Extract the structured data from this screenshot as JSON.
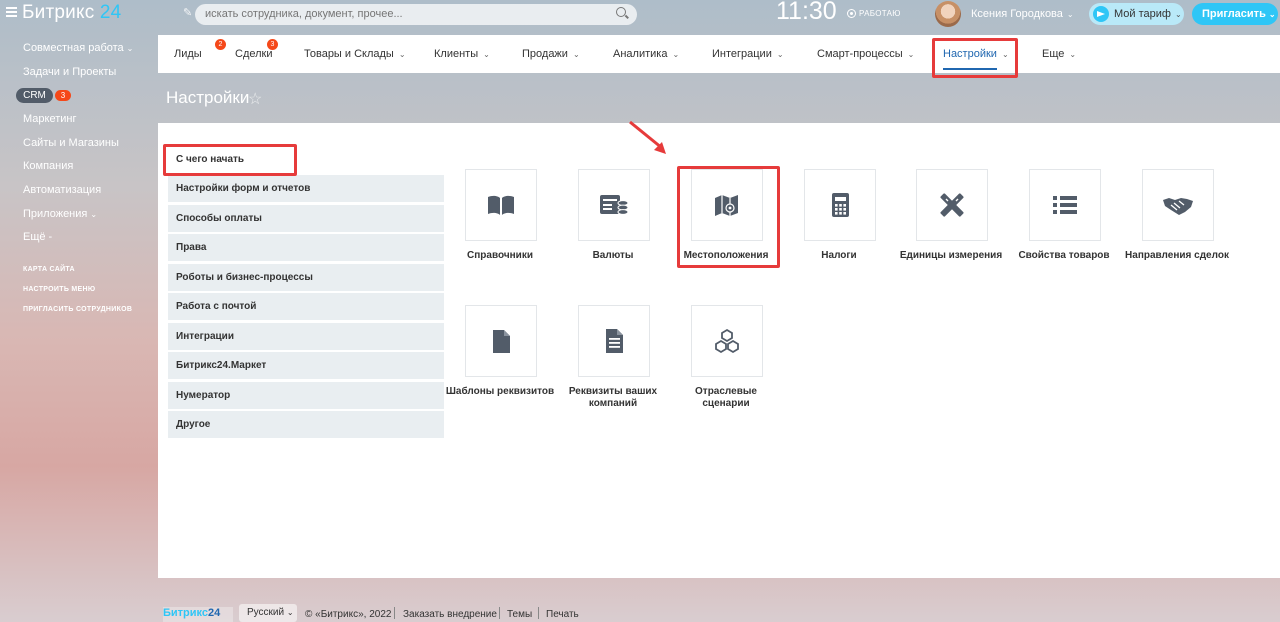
{
  "header": {
    "logo_text": "Битрикс",
    "logo_num": "24",
    "search_placeholder": "искать сотрудника, документ, прочее...",
    "time": "11:30",
    "work_status": "РАБОТАЮ",
    "user_name": "Ксения Городкова",
    "tariff_label": "Мой тариф",
    "invite_label": "Пригласить"
  },
  "sidebar": {
    "items": [
      {
        "label": "Совместная работа",
        "has_caret": true
      },
      {
        "label": "Задачи и Проекты"
      },
      {
        "label": "CRM",
        "badge": "3"
      },
      {
        "label": "Маркетинг"
      },
      {
        "label": "Сайты и Магазины"
      },
      {
        "label": "Компания"
      },
      {
        "label": "Автоматизация"
      },
      {
        "label": "Приложения",
        "has_caret": true
      },
      {
        "label": "Ещё -"
      }
    ],
    "small_links": [
      "КАРТА САЙТА",
      "НАСТРОИТЬ МЕНЮ",
      "ПРИГЛАСИТЬ СОТРУДНИКОВ"
    ]
  },
  "tabs": [
    {
      "label": "Лиды",
      "count": "2"
    },
    {
      "label": "Сделки",
      "count": "3"
    },
    {
      "label": "Товары и Склады"
    },
    {
      "label": "Клиенты"
    },
    {
      "label": "Продажи"
    },
    {
      "label": "Аналитика"
    },
    {
      "label": "Интеграции"
    },
    {
      "label": "Смарт-процессы"
    },
    {
      "label": "Настройки",
      "active": true
    },
    {
      "label": "Еще"
    }
  ],
  "page": {
    "title": "Настройки"
  },
  "settings_menu": [
    "С чего начать",
    "Настройки форм и отчетов",
    "Способы оплаты",
    "Права",
    "Роботы и бизнес-процессы",
    "Работа с почтой",
    "Интеграции",
    "Битрикс24.Маркет",
    "Нумератор",
    "Другое"
  ],
  "tiles": [
    {
      "label": "Справочники",
      "icon": "book-icon"
    },
    {
      "label": "Валюты",
      "icon": "currency-icon"
    },
    {
      "label": "Местоположения",
      "icon": "map-pin-icon"
    },
    {
      "label": "Налоги",
      "icon": "calculator-icon"
    },
    {
      "label": "Единицы измерения",
      "icon": "ruler-pencil-icon"
    },
    {
      "label": "Свойства товаров",
      "icon": "list-icon"
    },
    {
      "label": "Направления сделок",
      "icon": "handshake-icon"
    },
    {
      "label": "Шаблоны реквизитов",
      "icon": "document-icon"
    },
    {
      "label": "Реквизиты ваших компаний",
      "icon": "document-lines-icon"
    },
    {
      "label": "Отраслевые сценарии",
      "icon": "cubes-icon"
    }
  ],
  "footer": {
    "logo_text": "Битрикс",
    "logo_num": "24",
    "lang": "Русский",
    "copyright": "© «Битрикс», 2022",
    "links": [
      "Заказать внедрение",
      "Темы",
      "Печать"
    ]
  },
  "colors": {
    "accent": "#2fc6f6",
    "highlight": "#e63b3b",
    "active_tab": "#2067b0",
    "badge": "#f54819"
  }
}
